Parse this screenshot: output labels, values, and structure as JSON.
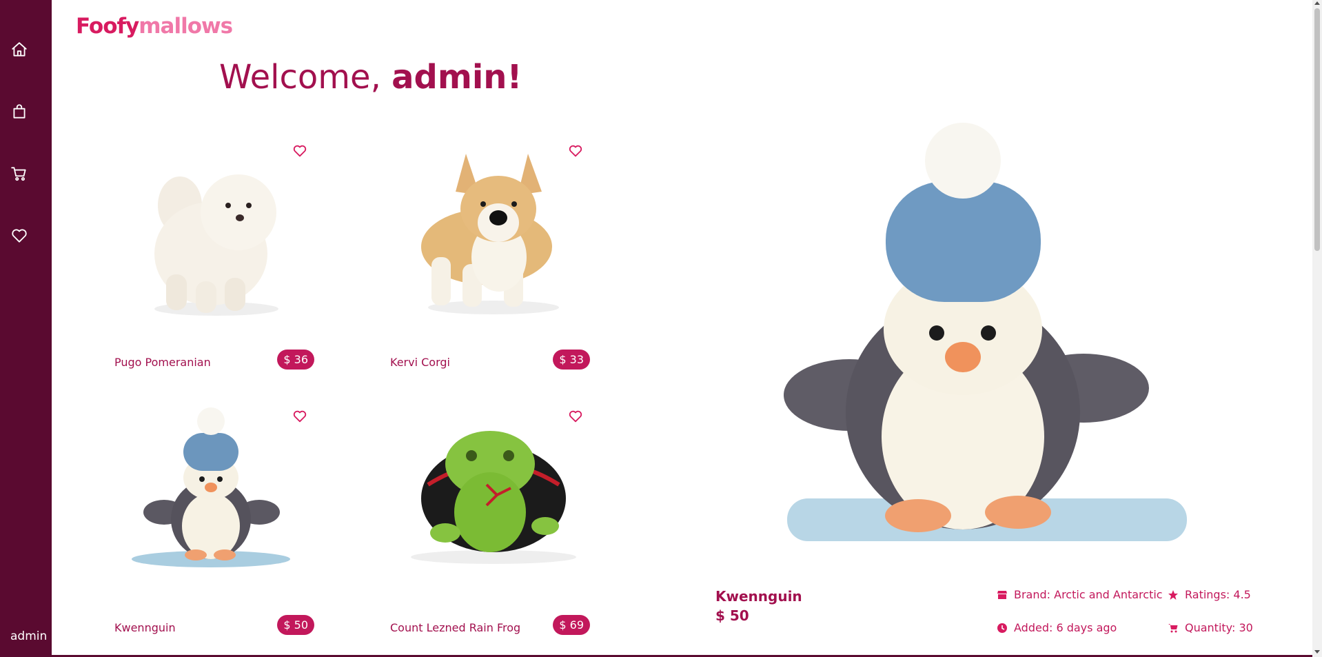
{
  "app": {
    "logo_part1": "Foofy",
    "logo_part2": "mallows",
    "welcome_prefix": "Welcome, ",
    "welcome_name": "admin!"
  },
  "sidebar": {
    "items": [
      {
        "icon": "home-icon"
      },
      {
        "icon": "shopping-bag-icon"
      },
      {
        "icon": "cart-icon"
      },
      {
        "icon": "heart-icon"
      }
    ],
    "username": "admin"
  },
  "products": [
    {
      "name": "Pugo Pomeranian",
      "price": "$ 36",
      "image": "white pomeranian plush"
    },
    {
      "name": "Kervi Corgi",
      "price": "$ 33",
      "image": "corgi plush"
    },
    {
      "name": "Kwennguin",
      "price": "$ 50",
      "image": "penguin on snowboard plush"
    },
    {
      "name": "Count Lezned Rain Frog",
      "price": "$ 69",
      "image": "green frog with cape plush"
    }
  ],
  "detail": {
    "name": "Kwennguin",
    "price": "$ 50",
    "brand": "Brand: Arctic and Antarctic",
    "ratings": "Ratings: 4.5",
    "added": "Added: 6 days ago",
    "quantity": "Quantity: 30"
  },
  "colors": {
    "sidebar": "#5a0a30",
    "accent": "#d81b60",
    "price_badge": "#c2185b",
    "heading": "#a2104e"
  }
}
